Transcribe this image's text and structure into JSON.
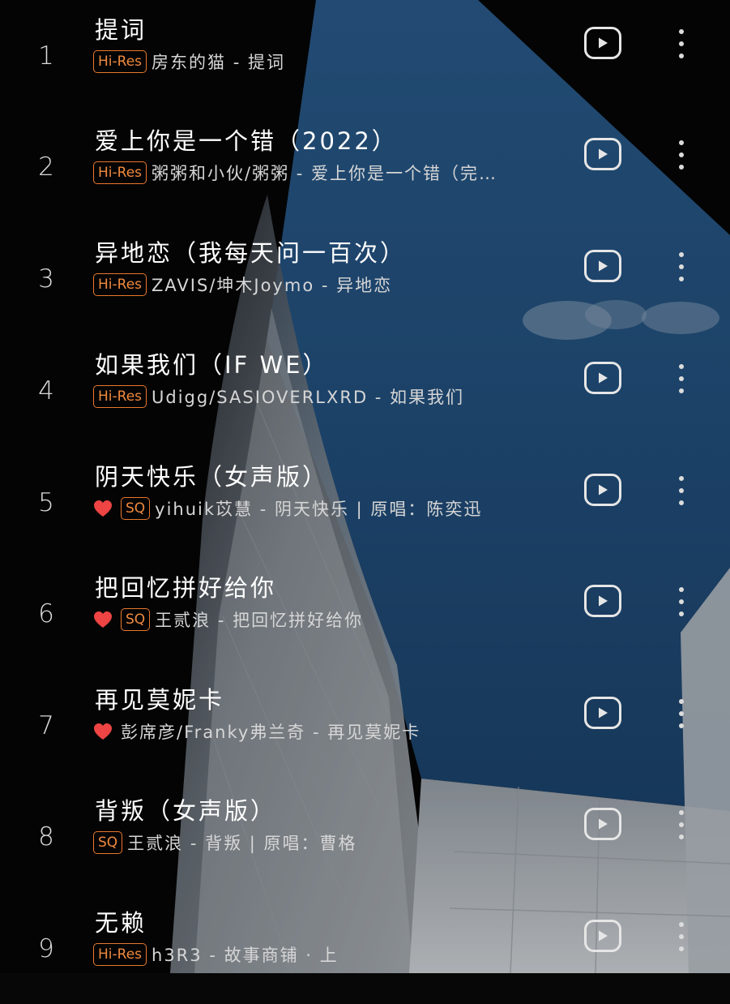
{
  "songs": [
    {
      "index": "1",
      "title": "提词",
      "badge": "Hi-Res",
      "favorite": false,
      "subtitle": "房东的猫 - 提词"
    },
    {
      "index": "2",
      "title": "爱上你是一个错（2022）",
      "badge": "Hi-Res",
      "favorite": false,
      "subtitle": "粥粥和小伙/粥粥 - 爱上你是一个错（完…"
    },
    {
      "index": "3",
      "title": "异地恋（我每天问一百次）",
      "badge": "Hi-Res",
      "favorite": false,
      "subtitle": "ZAVIS/坤木Joymo - 异地恋"
    },
    {
      "index": "4",
      "title": "如果我们（IF WE）",
      "badge": "Hi-Res",
      "favorite": false,
      "subtitle": "Udigg/SASIOVERLXRD - 如果我们"
    },
    {
      "index": "5",
      "title": "阴天快乐（女声版）",
      "badge": "SQ",
      "favorite": true,
      "subtitle": "yihuik苡慧 - 阴天快乐 | 原唱：陈奕迅"
    },
    {
      "index": "6",
      "title": "把回忆拼好给你",
      "badge": "SQ",
      "favorite": true,
      "subtitle": "王贰浪 - 把回忆拼好给你"
    },
    {
      "index": "7",
      "title": "再见莫妮卡",
      "badge": "",
      "favorite": true,
      "subtitle": "彭席彦/Franky弗兰奇 - 再见莫妮卡"
    },
    {
      "index": "8",
      "title": "背叛（女声版）",
      "badge": "SQ",
      "favorite": false,
      "subtitle": "王贰浪 - 背叛 | 原唱：曹格"
    },
    {
      "index": "9",
      "title": "无赖",
      "badge": "Hi-Res",
      "favorite": false,
      "subtitle": "h3R3 - 故事商铺 · 上"
    }
  ],
  "icons": {
    "play": "play-circle-icon",
    "more": "more-vertical-icon",
    "favorite": "heart-icon"
  },
  "colors": {
    "badge": "#e8782d",
    "heart": "#ef4444",
    "background": "#070707",
    "sky": "#26537f"
  }
}
